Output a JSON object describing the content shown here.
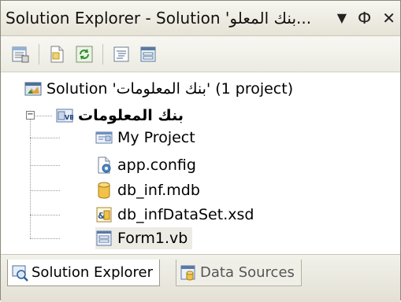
{
  "window": {
    "title": "Solution Explorer - Solution 'بنك المعلو...",
    "controls": {
      "dropdown": "▼",
      "pin": "Ф",
      "close": "✕"
    }
  },
  "toolbar": {
    "buttons": [
      {
        "name": "properties-button",
        "icon": "properties-icon"
      },
      {
        "name": "show-all-files-button",
        "icon": "show-all-files-icon"
      },
      {
        "name": "refresh-button",
        "icon": "refresh-icon"
      },
      {
        "name": "view-code-button",
        "icon": "view-code-icon"
      },
      {
        "name": "view-designer-button",
        "icon": "view-designer-icon"
      }
    ]
  },
  "tree": {
    "solution": {
      "label": "Solution 'بنك المعلومات' (1 project)",
      "icon": "solution-icon"
    },
    "project": {
      "label": "بنك المعلومات",
      "icon": "vb-project-icon",
      "expanded": true
    },
    "items": [
      {
        "label": "My Project",
        "icon": "my-project-icon"
      },
      {
        "label": "app.config",
        "icon": "config-file-icon"
      },
      {
        "label": "db_inf.mdb",
        "icon": "database-icon"
      },
      {
        "label": "db_infDataSet.xsd",
        "icon": "dataset-icon"
      },
      {
        "label": "Form1.vb",
        "icon": "form-icon",
        "selected": true
      }
    ]
  },
  "tabs": [
    {
      "label": "Solution Explorer",
      "icon": "solution-explorer-icon",
      "active": true
    },
    {
      "label": "Data Sources",
      "icon": "data-sources-icon",
      "active": false
    }
  ],
  "colors": {
    "chrome": "#ecebe2",
    "selection": "#ecebe4",
    "border": "#8a8a7a"
  }
}
